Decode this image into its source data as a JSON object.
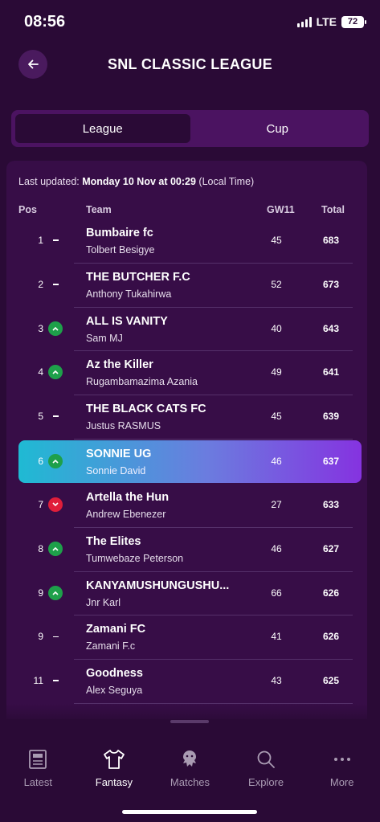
{
  "status": {
    "time": "08:56",
    "network": "LTE",
    "battery": "72"
  },
  "header": {
    "title": "SNL CLASSIC LEAGUE"
  },
  "segments": [
    {
      "label": "League",
      "active": true
    },
    {
      "label": "Cup",
      "active": false
    }
  ],
  "table": {
    "updated_prefix": "Last updated: ",
    "updated_value": "Monday 10 Nov at 00:29",
    "updated_suffix": " (Local Time)",
    "columns": {
      "pos": "Pos",
      "team": "Team",
      "gw": "GW11",
      "total": "Total"
    },
    "rows": [
      {
        "pos": "1",
        "movement": "same",
        "team": "Bumbaire fc",
        "manager": "Tolbert Besigye",
        "gw": "45",
        "total": "683"
      },
      {
        "pos": "2",
        "movement": "same",
        "team": "THE BUTCHER F.C",
        "manager": "Anthony Tukahirwa",
        "gw": "52",
        "total": "673"
      },
      {
        "pos": "3",
        "movement": "up",
        "team": "ALL IS VANITY",
        "manager": "Sam MJ",
        "gw": "40",
        "total": "643"
      },
      {
        "pos": "4",
        "movement": "up",
        "team": "Az the Killer",
        "manager": "Rugambamazima Azania",
        "gw": "49",
        "total": "641"
      },
      {
        "pos": "5",
        "movement": "same",
        "team": "THE BLACK CATS FC",
        "manager": "Justus RASMUS",
        "gw": "45",
        "total": "639"
      },
      {
        "pos": "6",
        "movement": "up",
        "team": "SONNIE UG",
        "manager": "Sonnie David",
        "gw": "46",
        "total": "637",
        "highlight": true
      },
      {
        "pos": "7",
        "movement": "down",
        "team": "Artella the Hun",
        "manager": "Andrew Ebenezer",
        "gw": "27",
        "total": "633"
      },
      {
        "pos": "8",
        "movement": "up",
        "team": "The Elites",
        "manager": "Tumwebaze Peterson",
        "gw": "46",
        "total": "627"
      },
      {
        "pos": "9",
        "movement": "up",
        "team": "KANYAMUSHUNGUSHU...",
        "manager": "Jnr Karl",
        "gw": "66",
        "total": "626"
      },
      {
        "pos": "9",
        "movement": "same",
        "team": "Zamani FC",
        "manager": "Zamani F.c",
        "gw": "41",
        "total": "626"
      },
      {
        "pos": "11",
        "movement": "same",
        "team": "Goodness",
        "manager": "Alex Seguya",
        "gw": "43",
        "total": "625"
      }
    ]
  },
  "tabs": [
    {
      "label": "Latest",
      "icon": "newspaper-icon",
      "active": false
    },
    {
      "label": "Fantasy",
      "icon": "shirt-icon",
      "active": true
    },
    {
      "label": "Matches",
      "icon": "lion-crest-icon",
      "active": false
    },
    {
      "label": "Explore",
      "icon": "search-icon",
      "active": false
    },
    {
      "label": "More",
      "icon": "more-dots-icon",
      "active": false
    }
  ],
  "colors": {
    "background": "#2a0a36",
    "panel": "#370d47",
    "up": "#1ea04a",
    "down": "#e01e3a",
    "highlight_start": "#1fbad3",
    "highlight_end": "#8533e0"
  }
}
